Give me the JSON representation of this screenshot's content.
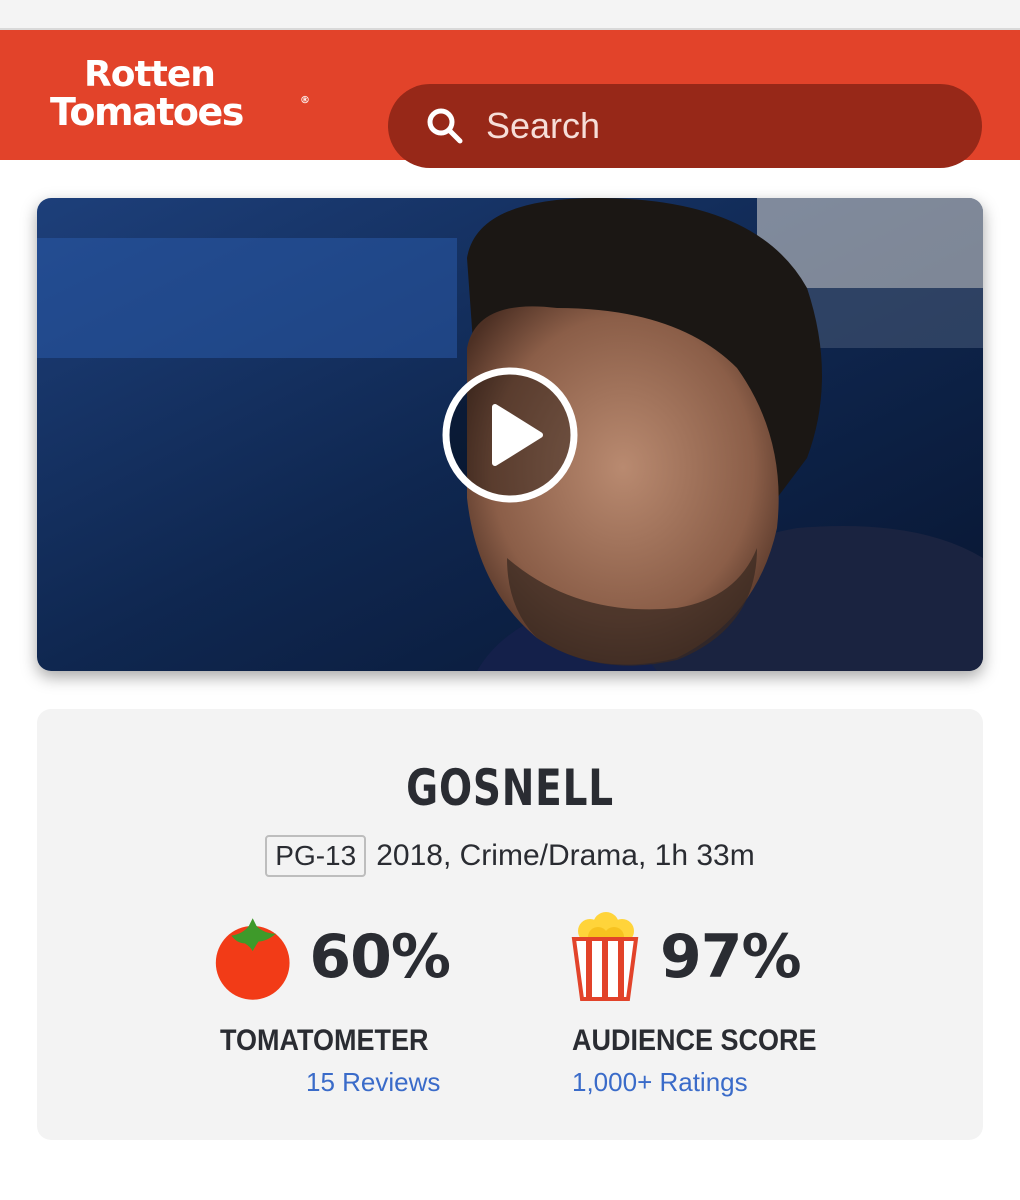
{
  "brand": {
    "logo_line1": "Rotten",
    "logo_line2": "Tomatoes",
    "logo_registered": "®"
  },
  "search": {
    "placeholder": "Search"
  },
  "colors": {
    "header": "#e2432a",
    "search_bg": "#972818",
    "link": "#3a6bc9",
    "text": "#2a2c32"
  },
  "video": {
    "play_icon": "play-icon"
  },
  "movie": {
    "title": "GOSNELL",
    "rating": "PG-13",
    "details": "2018, Crime/Drama, 1h 33m"
  },
  "scores": {
    "tomatometer": {
      "value": "60%",
      "label": "TOMATOMETER",
      "link": "15 Reviews",
      "icon": "tomato-icon"
    },
    "audience": {
      "value": "97%",
      "label": "AUDIENCE SCORE",
      "link": "1,000+ Ratings",
      "icon": "popcorn-icon"
    }
  }
}
